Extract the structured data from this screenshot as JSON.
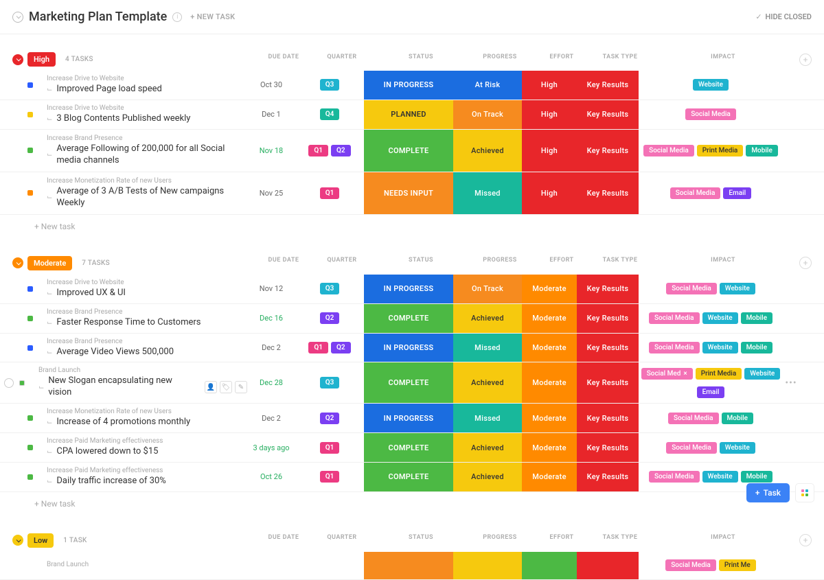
{
  "header": {
    "title": "Marketing Plan Template",
    "new_task": "+ NEW TASK",
    "hide_closed": "HIDE CLOSED"
  },
  "columns": {
    "due": "DUE DATE",
    "quarter": "QUARTER",
    "status": "STATUS",
    "progress": "PROGRESS",
    "effort": "EFFORT",
    "type": "TASK TYPE",
    "impact": "IMPACT"
  },
  "colors": {
    "blue": "#1b6de0",
    "teal": "#18b89b",
    "green": "#4cb944",
    "yellow": "#f6c90e",
    "orange": "#f68b1f",
    "red": "#e8262a",
    "purple": "#7b3ff2",
    "pink": "#ec3b82",
    "cyan": "#1fb3cf",
    "lpink": "#f472b6",
    "orange2": "#ff8a00",
    "sq_blue": "#2b5cff",
    "sq_yellow": "#f6c90e",
    "sq_green": "#4cb944",
    "sq_orange": "#ff8a00"
  },
  "new_task_row": "+ New task",
  "fab": {
    "task": "Task"
  },
  "groups": [
    {
      "label": "High",
      "count": "4 TASKS",
      "color": "#e8262a",
      "tasks": [
        {
          "cat": "Increase Drive to Website",
          "title": "Improved Page load speed",
          "due": "Oct 30",
          "due_green": false,
          "sq": "sq_blue",
          "tall": false,
          "quarters": [
            {
              "t": "Q3",
              "c": "cyan"
            }
          ],
          "status": {
            "t": "In Progress",
            "c": "blue",
            "uc": true
          },
          "progress": {
            "t": "At Risk",
            "c": "blue"
          },
          "effort": {
            "t": "High",
            "c": "red"
          },
          "type": {
            "t": "Key Results",
            "c": "red"
          },
          "impact": [
            {
              "t": "Website",
              "c": "cyan"
            }
          ]
        },
        {
          "cat": "Increase Drive to Website",
          "title": "3 Blog Contents Published weekly",
          "due": "Dec 1",
          "due_green": false,
          "sq": "sq_yellow",
          "tall": false,
          "quarters": [
            {
              "t": "Q4",
              "c": "teal"
            }
          ],
          "status": {
            "t": "Planned",
            "c": "yellow",
            "uc": true
          },
          "progress": {
            "t": "On Track",
            "c": "orange"
          },
          "effort": {
            "t": "High",
            "c": "red"
          },
          "type": {
            "t": "Key Results",
            "c": "red"
          },
          "impact": [
            {
              "t": "Social Media",
              "c": "lpink"
            }
          ]
        },
        {
          "cat": "Increase Brand Presence",
          "title": "Average Following of 200,000 for all Social media channels",
          "due": "Nov 18",
          "due_green": true,
          "sq": "sq_green",
          "tall": true,
          "quarters": [
            {
              "t": "Q1",
              "c": "pink"
            },
            {
              "t": "Q2",
              "c": "purple"
            }
          ],
          "status": {
            "t": "Complete",
            "c": "green",
            "uc": true
          },
          "progress": {
            "t": "Achieved",
            "c": "yellow"
          },
          "effort": {
            "t": "High",
            "c": "red"
          },
          "type": {
            "t": "Key Results",
            "c": "red"
          },
          "impact": [
            {
              "t": "Social Media",
              "c": "lpink"
            },
            {
              "t": "Print Media",
              "c": "yellow"
            },
            {
              "t": "Mobile",
              "c": "teal"
            }
          ]
        },
        {
          "cat": "Increase Monetization Rate of new Users",
          "title": "Average of 3 A/B Tests of New campaigns Weekly",
          "due": "Nov 25",
          "due_green": false,
          "sq": "sq_orange",
          "tall": true,
          "quarters": [
            {
              "t": "Q1",
              "c": "pink"
            }
          ],
          "status": {
            "t": "Needs Input",
            "c": "orange",
            "uc": true
          },
          "progress": {
            "t": "Missed",
            "c": "teal"
          },
          "effort": {
            "t": "High",
            "c": "red"
          },
          "type": {
            "t": "Key Results",
            "c": "red"
          },
          "impact": [
            {
              "t": "Social Media",
              "c": "lpink"
            },
            {
              "t": "Email",
              "c": "purple"
            }
          ]
        }
      ]
    },
    {
      "label": "Moderate",
      "count": "7 TASKS",
      "color": "#ff8a00",
      "tasks": [
        {
          "cat": "Increase Drive to Website",
          "title": "Improved UX & UI",
          "due": "Nov 12",
          "due_green": false,
          "sq": "sq_blue",
          "tall": false,
          "quarters": [
            {
              "t": "Q3",
              "c": "cyan"
            }
          ],
          "status": {
            "t": "In Progress",
            "c": "blue",
            "uc": true
          },
          "progress": {
            "t": "On Track",
            "c": "orange"
          },
          "effort": {
            "t": "Moderate",
            "c": "orange2"
          },
          "type": {
            "t": "Key Results",
            "c": "red"
          },
          "impact": [
            {
              "t": "Social Media",
              "c": "lpink"
            },
            {
              "t": "Website",
              "c": "cyan"
            }
          ]
        },
        {
          "cat": "Increase Brand Presence",
          "title": "Faster Response Time to Customers",
          "due": "Dec 16",
          "due_green": true,
          "sq": "sq_green",
          "tall": false,
          "quarters": [
            {
              "t": "Q2",
              "c": "purple"
            }
          ],
          "status": {
            "t": "Complete",
            "c": "green",
            "uc": true
          },
          "progress": {
            "t": "Achieved",
            "c": "yellow"
          },
          "effort": {
            "t": "Moderate",
            "c": "orange2"
          },
          "type": {
            "t": "Key Results",
            "c": "red"
          },
          "impact": [
            {
              "t": "Social Media",
              "c": "lpink"
            },
            {
              "t": "Website",
              "c": "cyan"
            },
            {
              "t": "Mobile",
              "c": "teal"
            }
          ]
        },
        {
          "cat": "Increase Brand Presence",
          "title": "Average Video Views 500,000",
          "due": "Dec 2",
          "due_green": false,
          "sq": "sq_blue",
          "tall": false,
          "quarters": [
            {
              "t": "Q1",
              "c": "pink"
            },
            {
              "t": "Q2",
              "c": "purple"
            }
          ],
          "status": {
            "t": "In Progress",
            "c": "blue",
            "uc": true
          },
          "progress": {
            "t": "Missed",
            "c": "teal"
          },
          "effort": {
            "t": "Moderate",
            "c": "orange2"
          },
          "type": {
            "t": "Key Results",
            "c": "red"
          },
          "impact": [
            {
              "t": "Social Media",
              "c": "lpink"
            },
            {
              "t": "Website",
              "c": "cyan"
            },
            {
              "t": "Mobile",
              "c": "teal"
            }
          ]
        },
        {
          "cat": "Brand Launch",
          "title": "New Slogan encapsulating new vision",
          "due": "Dec 28",
          "due_green": true,
          "sq": "sq_green",
          "tall": false,
          "hover": true,
          "quarters": [
            {
              "t": "Q3",
              "c": "cyan"
            }
          ],
          "status": {
            "t": "Complete",
            "c": "green",
            "uc": true
          },
          "progress": {
            "t": "Achieved",
            "c": "yellow"
          },
          "effort": {
            "t": "Moderate",
            "c": "orange2"
          },
          "type": {
            "t": "Key Results",
            "c": "red"
          },
          "impact": [
            {
              "t": "Social Med",
              "c": "lpink",
              "x": true
            },
            {
              "t": "Print Media",
              "c": "yellow"
            },
            {
              "t": "Website",
              "c": "cyan"
            },
            {
              "t": "Email",
              "c": "purple"
            }
          ]
        },
        {
          "cat": "Increase Monetization Rate of new Users",
          "title": "Increase of 4 promotions monthly",
          "due": "Dec 2",
          "due_green": false,
          "sq": "sq_green",
          "tall": false,
          "quarters": [
            {
              "t": "Q2",
              "c": "purple"
            }
          ],
          "status": {
            "t": "In Progress",
            "c": "blue",
            "uc": true
          },
          "progress": {
            "t": "Missed",
            "c": "teal"
          },
          "effort": {
            "t": "Moderate",
            "c": "orange2"
          },
          "type": {
            "t": "Key Results",
            "c": "red"
          },
          "impact": [
            {
              "t": "Social Media",
              "c": "lpink"
            },
            {
              "t": "Mobile",
              "c": "teal"
            }
          ]
        },
        {
          "cat": "Increase Paid Marketing effectiveness",
          "title": "CPA lowered down to $15",
          "due": "3 days ago",
          "due_green": true,
          "sq": "sq_green",
          "tall": false,
          "quarters": [
            {
              "t": "Q1",
              "c": "pink"
            }
          ],
          "status": {
            "t": "Complete",
            "c": "green",
            "uc": true
          },
          "progress": {
            "t": "Achieved",
            "c": "yellow"
          },
          "effort": {
            "t": "Moderate",
            "c": "orange2"
          },
          "type": {
            "t": "Key Results",
            "c": "red"
          },
          "impact": [
            {
              "t": "Social Media",
              "c": "lpink"
            },
            {
              "t": "Website",
              "c": "cyan"
            }
          ]
        },
        {
          "cat": "Increase Paid Marketing effectiveness",
          "title": "Daily traffic increase of 30%",
          "due": "Oct 26",
          "due_green": true,
          "sq": "sq_green",
          "tall": false,
          "quarters": [
            {
              "t": "Q1",
              "c": "pink"
            }
          ],
          "status": {
            "t": "Complete",
            "c": "green",
            "uc": true
          },
          "progress": {
            "t": "Achieved",
            "c": "yellow"
          },
          "effort": {
            "t": "Moderate",
            "c": "orange2"
          },
          "type": {
            "t": "Key Results",
            "c": "red"
          },
          "impact": [
            {
              "t": "Social Media",
              "c": "lpink"
            },
            {
              "t": "Website",
              "c": "cyan"
            },
            {
              "t": "Mobile",
              "c": "teal"
            }
          ]
        }
      ]
    },
    {
      "label": "Low",
      "count": "1 TASK",
      "color": "#f6c90e",
      "textColor": "#333",
      "tasks": [
        {
          "cat": "Brand Launch",
          "title": "",
          "due": "",
          "due_green": false,
          "sq": "",
          "tall": false,
          "quarters": [],
          "status": {
            "t": "",
            "c": "orange",
            "uc": true
          },
          "progress": {
            "t": "",
            "c": "yellow"
          },
          "effort": {
            "t": "",
            "c": "green"
          },
          "type": {
            "t": "",
            "c": "red"
          },
          "impact": [
            {
              "t": "Social Media",
              "c": "lpink"
            },
            {
              "t": "Print Me",
              "c": "yellow"
            }
          ]
        }
      ]
    }
  ]
}
